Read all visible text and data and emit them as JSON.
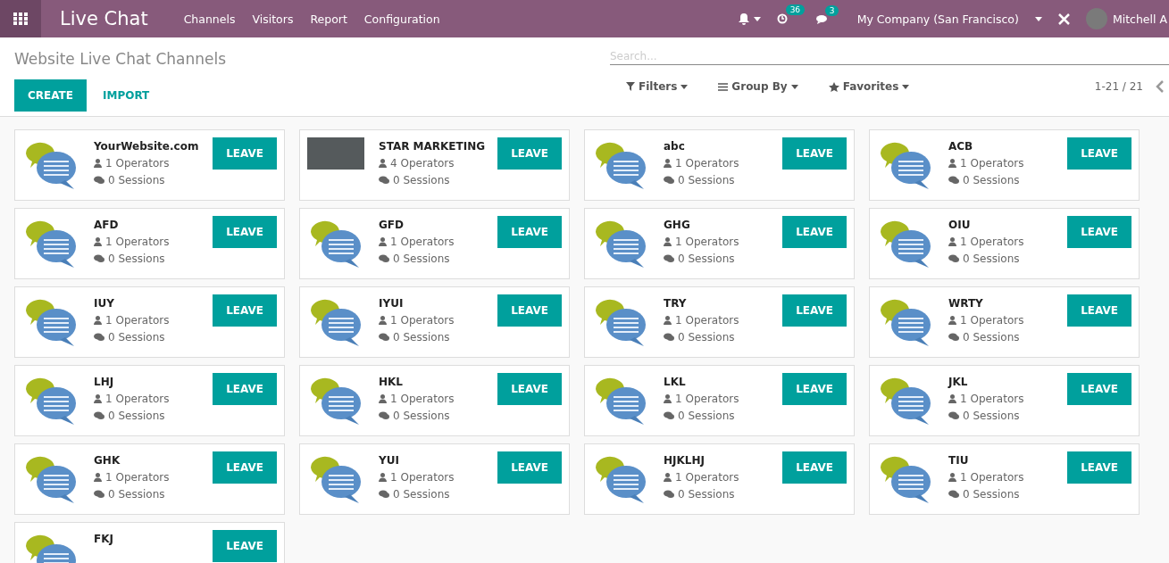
{
  "navbar": {
    "app_title": "Live Chat",
    "menu": [
      "Channels",
      "Visitors",
      "Report",
      "Configuration"
    ],
    "activity_badge": "36",
    "messages_badge": "3",
    "company": "My Company (San Francisco)",
    "user": "Mitchell A"
  },
  "control_panel": {
    "breadcrumb": "Website Live Chat Channels",
    "search": {
      "placeholder": "Search..."
    },
    "buttons": [
      "CREATE",
      "IMPORT"
    ],
    "filters": [
      "Filters",
      "Group By",
      "Favorites"
    ],
    "pager": "1-21 / 21"
  },
  "channels": [
    {
      "name": "YourWebsite.com",
      "kind": "chat",
      "operators": "1 Operators",
      "sessions": "0 Sessions",
      "action": "LEAVE"
    },
    {
      "name": "STAR MARKETING",
      "kind": "photo",
      "operators": "4 Operators",
      "sessions": "0 Sessions",
      "action": "LEAVE"
    },
    {
      "name": "abc",
      "kind": "chat",
      "operators": "1 Operators",
      "sessions": "0 Sessions",
      "action": "LEAVE"
    },
    {
      "name": "ACB",
      "kind": "chat",
      "operators": "1 Operators",
      "sessions": "0 Sessions",
      "action": "LEAVE"
    },
    {
      "name": "AFD",
      "kind": "chat",
      "operators": "1 Operators",
      "sessions": "0 Sessions",
      "action": "LEAVE"
    },
    {
      "name": "GFD",
      "kind": "chat",
      "operators": "1 Operators",
      "sessions": "0 Sessions",
      "action": "LEAVE"
    },
    {
      "name": "GHG",
      "kind": "chat",
      "operators": "1 Operators",
      "sessions": "0 Sessions",
      "action": "LEAVE"
    },
    {
      "name": "OIU",
      "kind": "chat",
      "operators": "1 Operators",
      "sessions": "0 Sessions",
      "action": "LEAVE"
    },
    {
      "name": "IUY",
      "kind": "chat",
      "operators": "1 Operators",
      "sessions": "0 Sessions",
      "action": "LEAVE"
    },
    {
      "name": "IYUI",
      "kind": "chat",
      "operators": "1 Operators",
      "sessions": "0 Sessions",
      "action": "LEAVE"
    },
    {
      "name": "TRY",
      "kind": "chat",
      "operators": "1 Operators",
      "sessions": "0 Sessions",
      "action": "LEAVE"
    },
    {
      "name": "WRTY",
      "kind": "chat",
      "operators": "1 Operators",
      "sessions": "0 Sessions",
      "action": "LEAVE"
    },
    {
      "name": "LHJ",
      "kind": "chat",
      "operators": "1 Operators",
      "sessions": "0 Sessions",
      "action": "LEAVE"
    },
    {
      "name": "HKL",
      "kind": "chat",
      "operators": "1 Operators",
      "sessions": "0 Sessions",
      "action": "LEAVE"
    },
    {
      "name": "LKL",
      "kind": "chat",
      "operators": "1 Operators",
      "sessions": "0 Sessions",
      "action": "LEAVE"
    },
    {
      "name": "JKL",
      "kind": "chat",
      "operators": "1 Operators",
      "sessions": "0 Sessions",
      "action": "LEAVE"
    },
    {
      "name": "GHK",
      "kind": "chat",
      "operators": "1 Operators",
      "sessions": "0 Sessions",
      "action": "LEAVE"
    },
    {
      "name": "YUI",
      "kind": "chat",
      "operators": "1 Operators",
      "sessions": "0 Sessions",
      "action": "LEAVE"
    },
    {
      "name": "HJKLHJ",
      "kind": "chat",
      "operators": "1 Operators",
      "sessions": "0 Sessions",
      "action": "LEAVE"
    },
    {
      "name": "TIU",
      "kind": "chat",
      "operators": "1 Operators",
      "sessions": "0 Sessions",
      "action": "LEAVE"
    },
    {
      "name": "FKJ",
      "kind": "chat",
      "action": "LEAVE"
    }
  ]
}
